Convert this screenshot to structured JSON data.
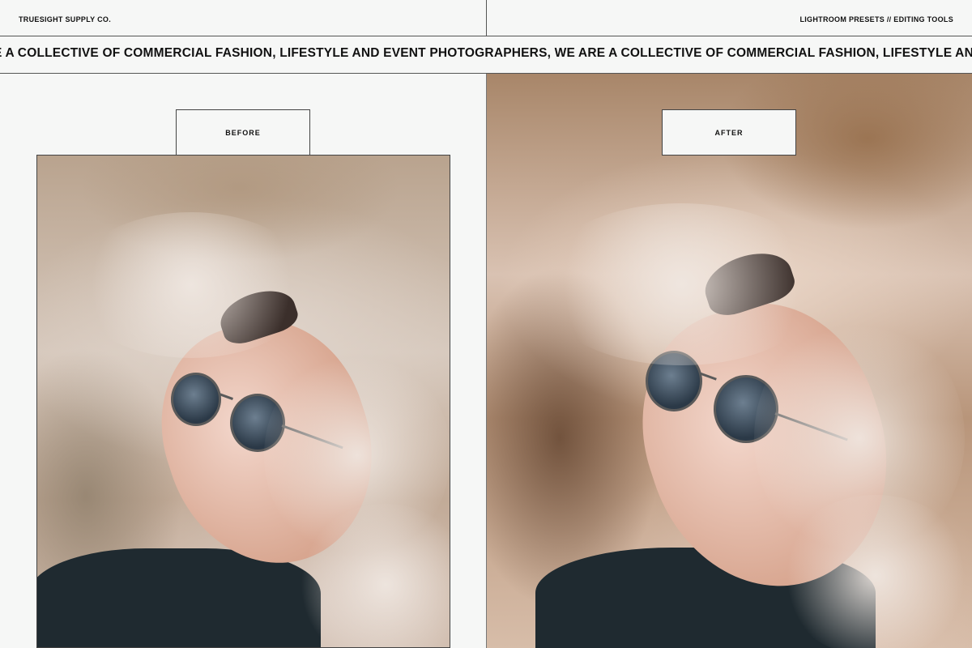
{
  "header": {
    "brand": "TRUESIGHT SUPPLY CO.",
    "tagline": "LIGHTROOM PRESETS // EDITING TOOLS"
  },
  "ticker": {
    "text": "E A COLLECTIVE OF COMMERCIAL FASHION, LIFESTYLE AND EVENT PHOTOGRAPHERS, WE ARE A COLLECTIVE OF COMMERCIAL FASHION, LIFESTYLE AND EVENT PHOTOGRA"
  },
  "comparison": {
    "before_label": "BEFORE",
    "after_label": "AFTER"
  }
}
